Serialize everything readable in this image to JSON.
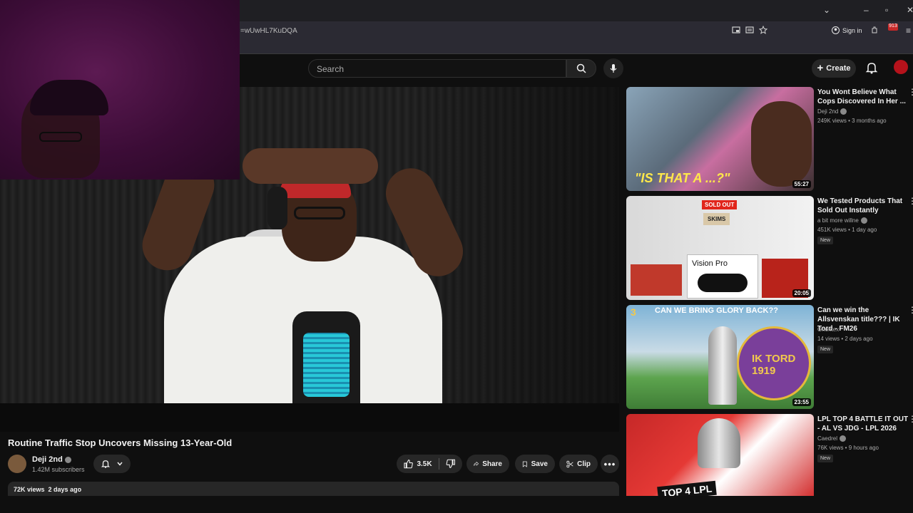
{
  "browser": {
    "url": "=wUwHL7KuDQA",
    "sign_in": "Sign in",
    "extension_badge": "913"
  },
  "masthead": {
    "search_placeholder": "Search",
    "create_label": "Create"
  },
  "video": {
    "title": "Routine Traffic Stop Uncovers Missing 13-Year-Old",
    "channel": "Deji 2nd",
    "subscribers": "1.42M subscribers",
    "likes": "3.5K",
    "share_label": "Share",
    "save_label": "Save",
    "clip_label": "Clip",
    "views": "72K views",
    "uploaded": "2 days ago"
  },
  "recommendations": [
    {
      "title": "You Wont Believe What Cops Discovered In Her ...",
      "channel": "Deji 2nd",
      "meta": "249K views • 3 months ago",
      "duration": "55:27",
      "badge": "",
      "thumb_text": "\"IS THAT A ...?\""
    },
    {
      "title": "We Tested Products That Sold Out Instantly",
      "channel": "a bit more willne",
      "meta": "451K views • 1 day ago",
      "duration": "20:05",
      "badge": "New",
      "thumb_text": "Vision Pro",
      "thumb_sold": "SOLD OUT",
      "thumb_skims": "SKIMS"
    },
    {
      "title": "Can we win the Allsvenskan title??? | IK Tord - FM26",
      "channel": "Gnontex",
      "meta": "14 views • 2 days ago",
      "duration": "23:55",
      "badge": "New",
      "thumb_text": "CAN WE BRING GLORY BACK??",
      "thumb_num": "3",
      "thumb_crest": "IK TORD 1919"
    },
    {
      "title": "LPL TOP 4 BATTLE IT OUT - AL VS JDG - LPL 2026",
      "channel": "Caedrel",
      "meta": "76K views • 9 hours ago",
      "duration": "",
      "badge": "New",
      "thumb_text": "TOP 4 LPL"
    }
  ],
  "colors": {
    "background": "#0f0f0f",
    "pill": "#272727",
    "secondary_text": "#aaaaaa",
    "webcam_tint": "#3b0c36"
  }
}
